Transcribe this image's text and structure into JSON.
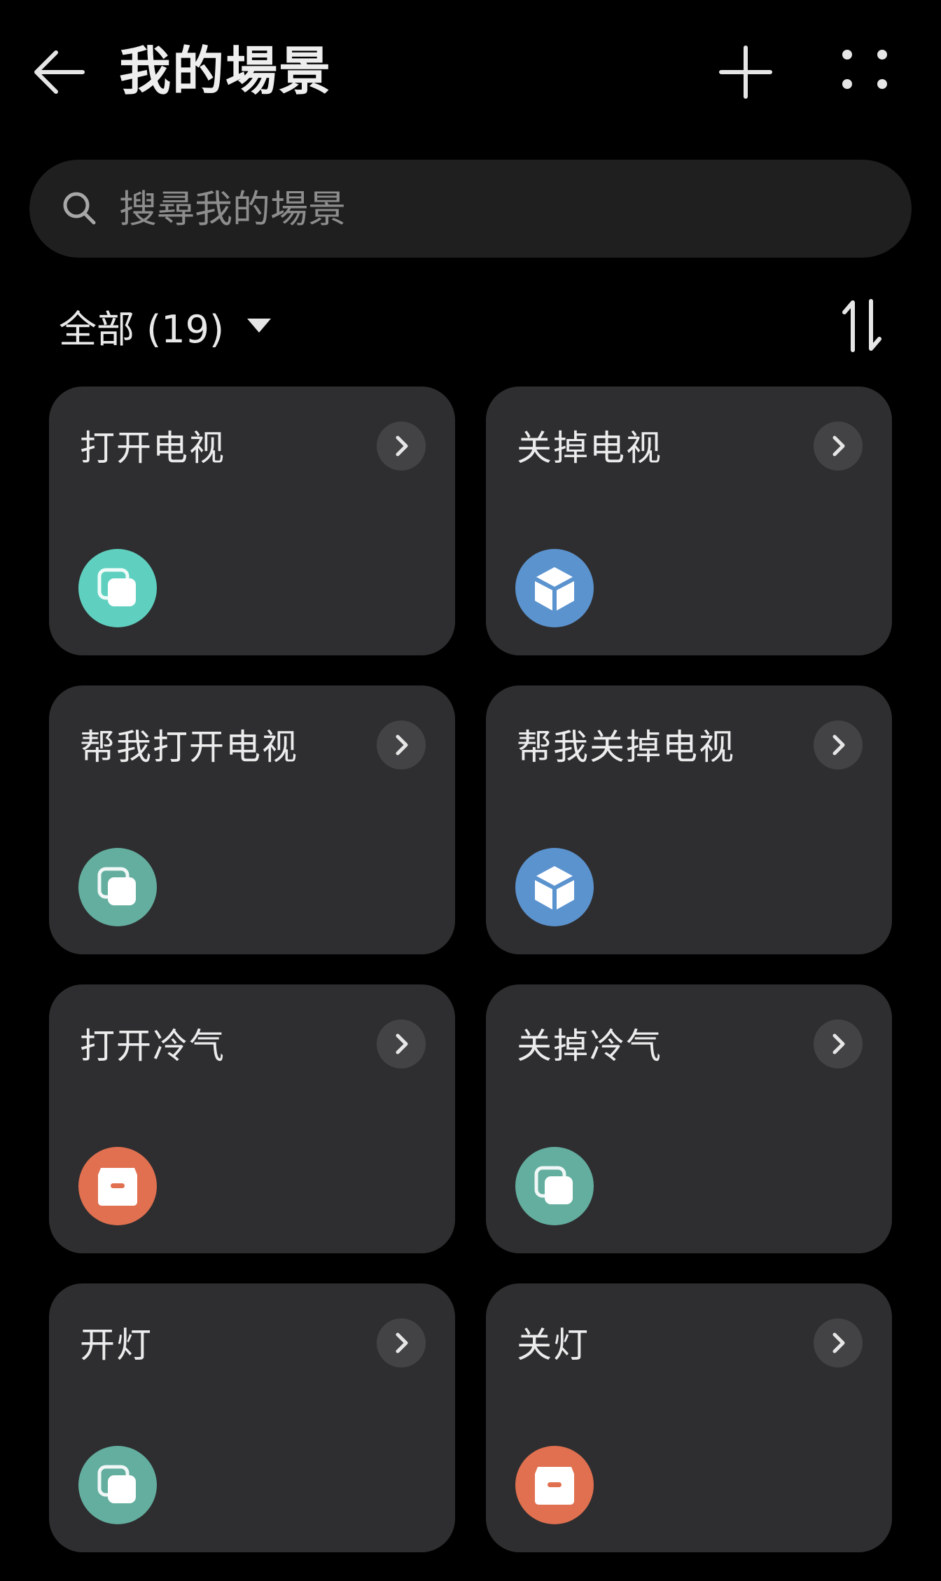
{
  "header": {
    "title": "我的場景"
  },
  "search": {
    "placeholder": "搜尋我的場景"
  },
  "filter": {
    "label": "全部 (19)"
  },
  "colors": {
    "background": "#000000",
    "card": "#2e2e30",
    "teal": "#5fd0c0",
    "sage": "#63ae9f",
    "blue": "#5b93cf",
    "orange": "#e0704f"
  },
  "scenes": [
    {
      "title": "打开电视",
      "icon": "layers-icon",
      "color": "#5fd0c0"
    },
    {
      "title": "关掉电视",
      "icon": "cube-icon",
      "color": "#5b93cf"
    },
    {
      "title": "帮我打开电视",
      "icon": "layers-icon",
      "color": "#63ae9f"
    },
    {
      "title": "帮我关掉电视",
      "icon": "cube-icon",
      "color": "#5b93cf"
    },
    {
      "title": "打开冷气",
      "icon": "box-icon",
      "color": "#e0704f"
    },
    {
      "title": "关掉冷气",
      "icon": "layers-icon",
      "color": "#63ae9f"
    },
    {
      "title": "开灯",
      "icon": "layers-icon",
      "color": "#63ae9f"
    },
    {
      "title": "关灯",
      "icon": "box-icon",
      "color": "#e0704f"
    }
  ]
}
